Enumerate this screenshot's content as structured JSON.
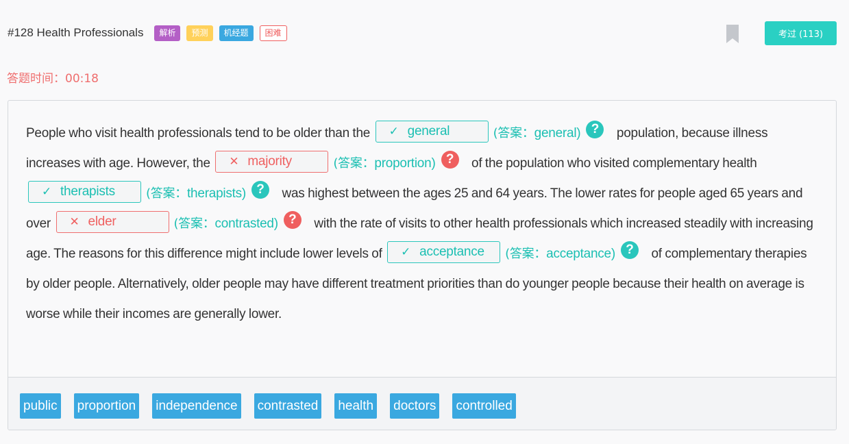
{
  "header": {
    "title": "#128 Health Professionals",
    "tags": [
      {
        "label": "解析",
        "color": "#b45fc6"
      },
      {
        "label": "预测",
        "color": "#ffd15a"
      },
      {
        "label": "机经题",
        "color": "#3aa8e0"
      },
      {
        "label": "困难",
        "color": "#ef5f5f"
      }
    ],
    "bookmark_icon": "bookmark-icon",
    "pass_button": "考过 (113)"
  },
  "timer": "答题时间：00:18",
  "passage": {
    "t0": "People who visit health professionals tend to be older than the",
    "t1": "population, because illness increases with age. However, the",
    "t2": "of the population who visited complementary health",
    "t3": "was highest between the ages 25 and 64 years. The lower rates for people aged 65 years and over",
    "t4": "with the rate of visits to other health professionals which increased steadily with increasing age. The reasons for this difference might include lower levels of",
    "t5": "of complementary therapies by older people. Alternatively, older people may have different treatment priorities than do younger people because their health on average is worse while their incomes are generally lower.",
    "answer_prefix": "答案：",
    "blanks": [
      {
        "value": "general",
        "answer": "general",
        "mark": "✓",
        "correct": true
      },
      {
        "value": "majority",
        "answer": "proportion",
        "mark": "✕",
        "correct": false
      },
      {
        "value": "therapists",
        "answer": "therapists",
        "mark": "✓",
        "correct": true
      },
      {
        "value": "elder",
        "answer": "contrasted",
        "mark": "✕",
        "correct": false
      },
      {
        "value": "acceptance",
        "answer": "acceptance",
        "mark": "✓",
        "correct": true
      }
    ],
    "help_glyph": "?"
  },
  "options": [
    "public",
    "proportion",
    "independence",
    "contrasted",
    "health",
    "doctors",
    "controlled"
  ],
  "colors": {
    "correct": "#2ac6bc",
    "wrong": "#ef5f5f",
    "option_bg": "#3aa8e0",
    "pass_btn": "#2ad0c3"
  }
}
